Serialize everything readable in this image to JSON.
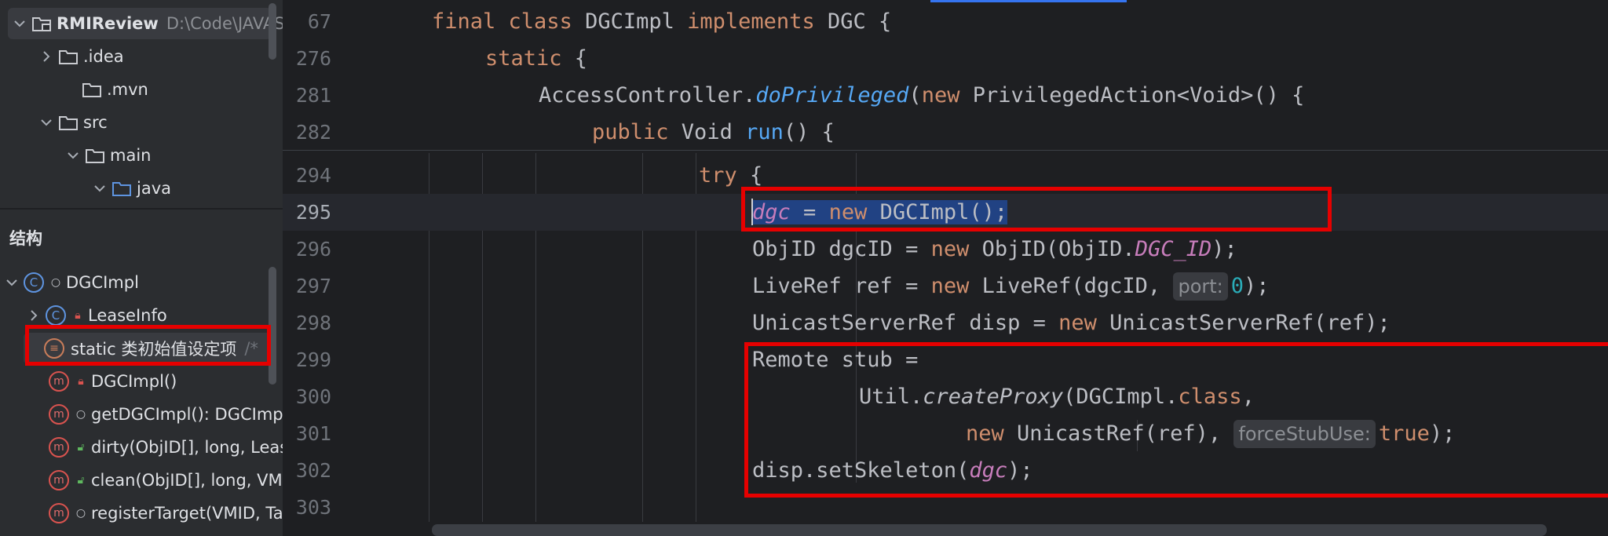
{
  "project": {
    "name": "RMIReview",
    "path": "D:\\Code\\JAVAS",
    "tree": [
      {
        "label": ".idea"
      },
      {
        "label": ".mvn"
      },
      {
        "label": "src"
      },
      {
        "label": "main"
      },
      {
        "label": "java"
      }
    ]
  },
  "structure": {
    "title": "结构",
    "root": "DGCImpl",
    "items": [
      {
        "label": "LeaseInfo",
        "icon": "class-icon"
      },
      {
        "label": "static 类初始值设定项",
        "suffix": "/*",
        "icon": "static-initializer-icon"
      },
      {
        "label": "DGCImpl()",
        "icon": "method-icon"
      },
      {
        "label": "getDGCImpl(): DGCImp",
        "icon": "method-icon"
      },
      {
        "label": "dirty(ObjID[], long, Leas",
        "icon": "method-icon"
      },
      {
        "label": "clean(ObjID[], long, VM",
        "icon": "method-icon"
      },
      {
        "label": "registerTarget(VMID, Ta",
        "icon": "method-icon"
      }
    ]
  },
  "editor": {
    "line_numbers": [
      "67",
      "276",
      "281",
      "282",
      "294",
      "295",
      "296",
      "297",
      "298",
      "299",
      "300",
      "301",
      "302",
      "303"
    ],
    "tokens": {
      "l67": [
        "final",
        " ",
        "class",
        " DGCImpl ",
        "implements",
        " DGC {"
      ],
      "l276": [
        "static",
        " {"
      ],
      "l281": [
        "AccessController.",
        "doPrivileged",
        "(",
        "new",
        " PrivilegedAction<Void>() {"
      ],
      "l282": [
        "public",
        " Void ",
        "run",
        "() {"
      ],
      "l294": [
        "try",
        " {"
      ],
      "l295": [
        "dgc",
        " = ",
        "new",
        " DGCImpl();"
      ],
      "l296": [
        "ObjID dgcID = ",
        "new",
        " ObjID(ObjID.",
        "DGC_ID",
        ");"
      ],
      "l297": [
        "LiveRef ref = ",
        "new",
        " LiveRef(dgcID, ",
        "port:",
        "0",
        ");"
      ],
      "l298": [
        "UnicastServerRef disp = ",
        "new",
        " UnicastServerRef(ref);"
      ],
      "l299": [
        "Remote stub ="
      ],
      "l300": [
        "Util.",
        "createProxy",
        "(DGCImpl.",
        "class",
        ","
      ],
      "l301": [
        "new",
        " UnicastRef(ref), ",
        "forceStubUse:",
        "true",
        ");"
      ],
      "l302": [
        "disp.setSkeleton(",
        "dgc",
        ");"
      ]
    }
  },
  "colors": {
    "keyword": "#cf8e6d",
    "method": "#56a8f5",
    "field": "#c77dbb",
    "number": "#2aacb8",
    "highlight_box": "#e60000",
    "selection": "#214283"
  }
}
